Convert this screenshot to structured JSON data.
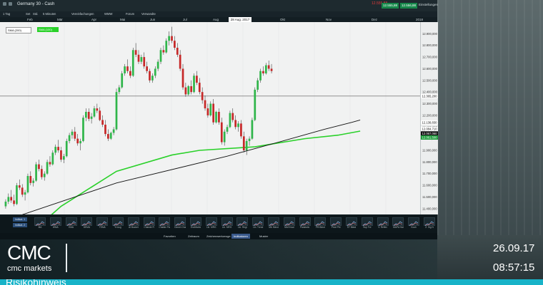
{
  "window": {
    "title": "Germany 30 - Cash"
  },
  "header": {
    "red_value": "12.555,88",
    "sell_price": "12.555,88",
    "buy_price": "12.556,88",
    "settings_label": "Einstellungen"
  },
  "toolbar": {
    "timeframe": "1 Tag",
    "items": [
      "Set",
      "Std.",
      "5 Minuten",
      "Vereinfachungen",
      "WMW",
      "Forum",
      "Verwandte"
    ]
  },
  "months": [
    "Feb",
    "Mär",
    "Apr",
    "Mai",
    "Jun",
    "Jul",
    "Aug",
    "Okt",
    "Nov",
    "Dez",
    "2018"
  ],
  "crosshair_date": "28 Aug. 2017",
  "legend": {
    "sma1": "SMA (200)",
    "sma2": "SMA (100)"
  },
  "colors": {
    "sma200": "#111111",
    "sma100": "#2ad12a",
    "bull": "#2fb54a",
    "bear": "#c62828",
    "current_price_bg": "#1d9c3b"
  },
  "axis": {
    "ticks": [
      "12.900,000",
      "12.800,000",
      "12.700,000",
      "12.600,000",
      "12.500,000",
      "12.400,000",
      "12.300,000",
      "12.200,000",
      "12.100,000",
      "12.000,000",
      "11.900,000",
      "11.800,000",
      "11.700,000",
      "11.600,000",
      "11.500,000",
      "11.400,000"
    ],
    "marker_hline": "12.365,200",
    "marker_sma200": "12.138,830",
    "marker_sma100_a": "12.084,710",
    "marker_price": "12.067,060",
    "marker_green2": "12.061,500"
  },
  "chart_data": {
    "type": "candlestick",
    "ylim": [
      11350,
      13000
    ],
    "hline": 12365.2,
    "candles": [
      [
        11420,
        11480,
        11400,
        11460
      ],
      [
        11460,
        11530,
        11440,
        11500
      ],
      [
        11500,
        11560,
        11450,
        11470
      ],
      [
        11470,
        11520,
        11420,
        11440
      ],
      [
        11440,
        11620,
        11430,
        11600
      ],
      [
        11600,
        11650,
        11560,
        11580
      ],
      [
        11580,
        11610,
        11500,
        11520
      ],
      [
        11520,
        11560,
        11470,
        11540
      ],
      [
        11540,
        11700,
        11530,
        11680
      ],
      [
        11680,
        11720,
        11600,
        11620
      ],
      [
        11620,
        11660,
        11590,
        11640
      ],
      [
        11640,
        11800,
        11630,
        11780
      ],
      [
        11780,
        11820,
        11720,
        11740
      ],
      [
        11740,
        11770,
        11650,
        11670
      ],
      [
        11670,
        11720,
        11640,
        11700
      ],
      [
        11700,
        11820,
        11690,
        11800
      ],
      [
        11800,
        11850,
        11760,
        11780
      ],
      [
        11780,
        11900,
        11770,
        11880
      ],
      [
        11880,
        11950,
        11860,
        11930
      ],
      [
        11930,
        11990,
        11880,
        11900
      ],
      [
        11900,
        11930,
        11800,
        11820
      ],
      [
        11820,
        11870,
        11790,
        11850
      ],
      [
        11850,
        12000,
        11840,
        11980
      ],
      [
        11980,
        12050,
        11960,
        12030
      ],
      [
        12030,
        12080,
        12000,
        12060
      ],
      [
        12060,
        12100,
        11980,
        12000
      ],
      [
        12000,
        12040,
        11940,
        11960
      ],
      [
        11960,
        12000,
        11900,
        11980
      ],
      [
        11980,
        12200,
        11970,
        12180
      ],
      [
        12180,
        12260,
        12150,
        12230
      ],
      [
        12230,
        12260,
        12150,
        12170
      ],
      [
        12170,
        12220,
        12130,
        12190
      ],
      [
        12190,
        12280,
        12180,
        12260
      ],
      [
        12260,
        12300,
        12220,
        12240
      ],
      [
        12240,
        12270,
        12150,
        12160
      ],
      [
        12160,
        12200,
        12100,
        12120
      ],
      [
        12120,
        12160,
        12020,
        12040
      ],
      [
        12040,
        12080,
        11980,
        12000
      ],
      [
        12000,
        12060,
        11990,
        12050
      ],
      [
        12050,
        12100,
        12030,
        12080
      ],
      [
        12080,
        12430,
        12070,
        12400
      ],
      [
        12400,
        12460,
        12380,
        12440
      ],
      [
        12440,
        12580,
        12430,
        12560
      ],
      [
        12560,
        12640,
        12540,
        12620
      ],
      [
        12620,
        12680,
        12560,
        12580
      ],
      [
        12580,
        12620,
        12520,
        12540
      ],
      [
        12540,
        12780,
        12530,
        12760
      ],
      [
        12760,
        12820,
        12700,
        12720
      ],
      [
        12720,
        12760,
        12640,
        12660
      ],
      [
        12660,
        12720,
        12640,
        12700
      ],
      [
        12700,
        12740,
        12600,
        12620
      ],
      [
        12620,
        12660,
        12560,
        12580
      ],
      [
        12580,
        12600,
        12480,
        12500
      ],
      [
        12500,
        12560,
        12480,
        12540
      ],
      [
        12540,
        12620,
        12520,
        12600
      ],
      [
        12600,
        12680,
        12580,
        12660
      ],
      [
        12660,
        12780,
        12640,
        12760
      ],
      [
        12760,
        12800,
        12720,
        12740
      ],
      [
        12740,
        12860,
        12730,
        12840
      ],
      [
        12840,
        12920,
        12800,
        12880
      ],
      [
        12880,
        12960,
        12820,
        12840
      ],
      [
        12840,
        12880,
        12760,
        12780
      ],
      [
        12780,
        12820,
        12700,
        12720
      ],
      [
        12720,
        12760,
        12580,
        12600
      ],
      [
        12600,
        12640,
        12420,
        12440
      ],
      [
        12440,
        12480,
        12360,
        12380
      ],
      [
        12380,
        12460,
        12370,
        12450
      ],
      [
        12450,
        12500,
        12380,
        12400
      ],
      [
        12400,
        12560,
        12390,
        12540
      ],
      [
        12540,
        12580,
        12460,
        12480
      ],
      [
        12480,
        12520,
        12380,
        12400
      ],
      [
        12400,
        12440,
        12300,
        12330
      ],
      [
        12330,
        12370,
        12240,
        12260
      ],
      [
        12260,
        12300,
        12180,
        12200
      ],
      [
        12200,
        12320,
        12190,
        12300
      ],
      [
        12300,
        12340,
        12120,
        12140
      ],
      [
        12140,
        12240,
        12130,
        12230
      ],
      [
        12230,
        12260,
        12120,
        12140
      ],
      [
        12140,
        12180,
        11950,
        11970
      ],
      [
        11970,
        12080,
        11940,
        12060
      ],
      [
        12060,
        12120,
        12040,
        12100
      ],
      [
        12100,
        12240,
        12090,
        12220
      ],
      [
        12220,
        12260,
        12140,
        12160
      ],
      [
        12160,
        12200,
        12080,
        12100
      ],
      [
        12100,
        12150,
        12060,
        12130
      ],
      [
        12130,
        12160,
        12000,
        12020
      ],
      [
        12020,
        12060,
        11880,
        11900
      ],
      [
        11900,
        12000,
        11860,
        11980
      ],
      [
        11980,
        12020,
        11940,
        12000
      ],
      [
        12000,
        12180,
        11990,
        12160
      ],
      [
        12160,
        12440,
        12150,
        12420
      ],
      [
        12420,
        12520,
        12400,
        12500
      ],
      [
        12500,
        12600,
        12480,
        12580
      ],
      [
        12580,
        12620,
        12540,
        12560
      ],
      [
        12560,
        12650,
        12550,
        12630
      ],
      [
        12630,
        12670,
        12580,
        12600
      ],
      [
        12600,
        12640,
        12560,
        12580
      ]
    ],
    "sma200": [
      [
        0,
        11300
      ],
      [
        40,
        11620
      ],
      [
        80,
        11850
      ],
      [
        100,
        11980
      ],
      [
        115,
        12080
      ],
      [
        125,
        12140
      ],
      [
        128,
        12160
      ]
    ],
    "sma100": [
      [
        0,
        11000
      ],
      [
        20,
        11420
      ],
      [
        40,
        11720
      ],
      [
        60,
        11860
      ],
      [
        70,
        11900
      ],
      [
        90,
        11930
      ],
      [
        108,
        12000
      ],
      [
        120,
        12030
      ],
      [
        128,
        12065
      ]
    ]
  },
  "indicators": {
    "top_buttons": [
      "Indikat. 1",
      "Indikat. 2"
    ],
    "items": [
      "MA",
      "WMA",
      "EMA",
      "DEMA",
      "TEMA",
      "% Aug",
      "AI Bucket",
      "Chande R",
      "Chaikin Fluss",
      "Donch Chan",
      "EnvMatrix",
      "Lin. MRG",
      "Lin. MRG",
      "Lin. Regr",
      "Lin. Trend",
      "Mit. Bänd",
      "MA Enval",
      "Parabolic",
      "PB Bänd",
      "Pivot Pkt",
      "ST Bänd",
      "Sup Fol",
      "V. Reflex",
      "MAPA Hat",
      "Koch",
      "Z. Sig N"
    ]
  },
  "bottom_tabs": [
    "Favoriten",
    "Zeitraum",
    "Zeichenwerkzeuge",
    "Indikatoren",
    "Muster"
  ],
  "brand": {
    "logo_text": "CMC",
    "logo_sub": "cmc markets"
  },
  "overlay": {
    "date": "26.09.17",
    "time": "08:57:15",
    "risk_text": "Risikohinweis"
  }
}
